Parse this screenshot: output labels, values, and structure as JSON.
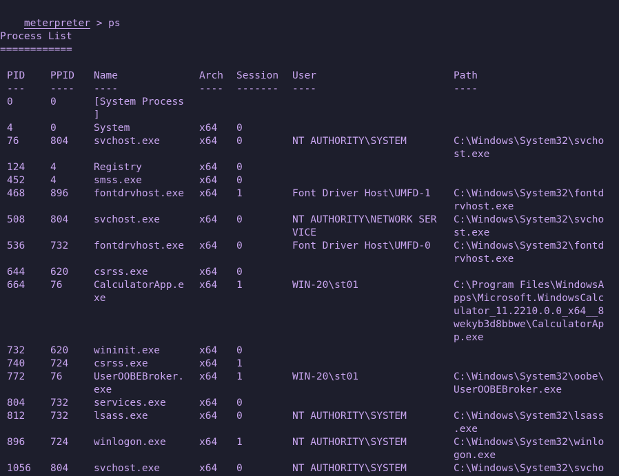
{
  "prompt": {
    "session": "meterpreter",
    "arrow": ">",
    "command": "ps"
  },
  "title": "Process List",
  "title_rule": "============",
  "headers": {
    "pid": "PID",
    "ppid": "PPID",
    "name": "Name",
    "arch": "Arch",
    "session": "Session",
    "user": "User",
    "path": "Path"
  },
  "separators": {
    "pid": "---",
    "ppid": "----",
    "name": "----",
    "arch": "----",
    "session": "-------",
    "user": "----",
    "path": "----"
  },
  "processes": [
    {
      "pid": "0",
      "ppid": "0",
      "name": [
        "[System Process",
        "]"
      ],
      "arch": "",
      "session": "",
      "user": [],
      "path": []
    },
    {
      "pid": "4",
      "ppid": "0",
      "name": [
        "System"
      ],
      "arch": "x64",
      "session": "0",
      "user": [],
      "path": []
    },
    {
      "pid": "76",
      "ppid": "804",
      "name": [
        "svchost.exe"
      ],
      "arch": "x64",
      "session": "0",
      "user": [
        "NT AUTHORITY\\SYSTEM"
      ],
      "path": [
        "C:\\Windows\\System32\\svcho",
        "st.exe"
      ]
    },
    {
      "pid": "124",
      "ppid": "4",
      "name": [
        "Registry"
      ],
      "arch": "x64",
      "session": "0",
      "user": [],
      "path": []
    },
    {
      "pid": "452",
      "ppid": "4",
      "name": [
        "smss.exe"
      ],
      "arch": "x64",
      "session": "0",
      "user": [],
      "path": []
    },
    {
      "pid": "468",
      "ppid": "896",
      "name": [
        "fontdrvhost.exe"
      ],
      "arch": "x64",
      "session": "1",
      "user": [
        "Font Driver Host\\UMFD-1"
      ],
      "path": [
        "C:\\Windows\\System32\\fontd",
        "rvhost.exe"
      ]
    },
    {
      "pid": "508",
      "ppid": "804",
      "name": [
        "svchost.exe"
      ],
      "arch": "x64",
      "session": "0",
      "user": [
        "NT AUTHORITY\\NETWORK SER",
        "VICE"
      ],
      "path": [
        "C:\\Windows\\System32\\svcho",
        "st.exe"
      ]
    },
    {
      "pid": "536",
      "ppid": "732",
      "name": [
        "fontdrvhost.exe"
      ],
      "arch": "x64",
      "session": "0",
      "user": [
        "Font Driver Host\\UMFD-0"
      ],
      "path": [
        "C:\\Windows\\System32\\fontd",
        "rvhost.exe"
      ]
    },
    {
      "pid": "644",
      "ppid": "620",
      "name": [
        "csrss.exe"
      ],
      "arch": "x64",
      "session": "0",
      "user": [],
      "path": []
    },
    {
      "pid": "664",
      "ppid": "76",
      "name": [
        "CalculatorApp.e",
        "xe"
      ],
      "arch": "x64",
      "session": "1",
      "user": [
        "WIN-20\\st01"
      ],
      "path": [
        "C:\\Program Files\\WindowsA",
        "pps\\Microsoft.WindowsCalc",
        "ulator_11.2210.0.0_x64__8",
        "wekyb3d8bbwe\\CalculatorAp",
        "p.exe"
      ]
    },
    {
      "pid": "732",
      "ppid": "620",
      "name": [
        "wininit.exe"
      ],
      "arch": "x64",
      "session": "0",
      "user": [],
      "path": []
    },
    {
      "pid": "740",
      "ppid": "724",
      "name": [
        "csrss.exe"
      ],
      "arch": "x64",
      "session": "1",
      "user": [],
      "path": []
    },
    {
      "pid": "772",
      "ppid": "76",
      "name": [
        "UserOOBEBroker.",
        "exe"
      ],
      "arch": "x64",
      "session": "1",
      "user": [
        "WIN-20\\st01"
      ],
      "path": [
        "C:\\Windows\\System32\\oobe\\",
        "UserOOBEBroker.exe"
      ]
    },
    {
      "pid": "804",
      "ppid": "732",
      "name": [
        "services.exe"
      ],
      "arch": "x64",
      "session": "0",
      "user": [],
      "path": []
    },
    {
      "pid": "812",
      "ppid": "732",
      "name": [
        "lsass.exe"
      ],
      "arch": "x64",
      "session": "0",
      "user": [
        "NT AUTHORITY\\SYSTEM"
      ],
      "path": [
        "C:\\Windows\\System32\\lsass",
        ".exe"
      ]
    },
    {
      "pid": "896",
      "ppid": "724",
      "name": [
        "winlogon.exe"
      ],
      "arch": "x64",
      "session": "1",
      "user": [
        "NT AUTHORITY\\SYSTEM"
      ],
      "path": [
        "C:\\Windows\\System32\\winlo",
        "gon.exe"
      ]
    },
    {
      "pid": "1056",
      "ppid": "804",
      "name": [
        "svchost.exe"
      ],
      "arch": "x64",
      "session": "0",
      "user": [
        "NT AUTHORITY\\SYSTEM"
      ],
      "path": [
        "C:\\Windows\\System32\\svcho"
      ]
    }
  ]
}
